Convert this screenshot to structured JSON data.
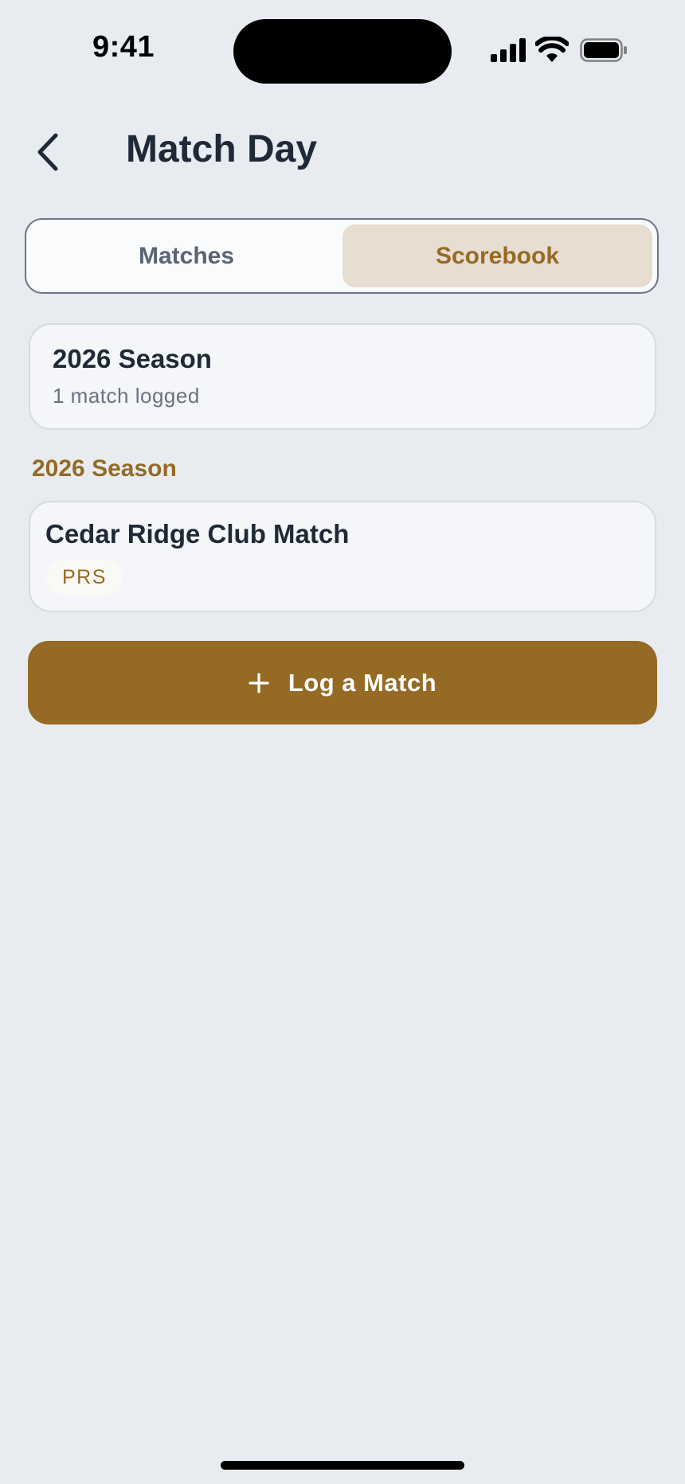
{
  "status_bar": {
    "time": "9:41"
  },
  "header": {
    "title": "Match Day"
  },
  "tabs": [
    {
      "label": "Matches",
      "selected": false
    },
    {
      "label": "Scorebook",
      "selected": true
    }
  ],
  "season_summary": {
    "title": "2026 Season",
    "subtitle": "1 match logged"
  },
  "section": {
    "label": "2026 Season"
  },
  "matches": [
    {
      "title": "Cedar Ridge Club Match",
      "badge": "PRS"
    }
  ],
  "actions": {
    "log_match_label": "Log a Match"
  },
  "colors": {
    "background": "#E8ECF0",
    "accent": "#956A24",
    "selected_tab_bg": "#E8DDD1",
    "text_primary": "#1F2937"
  }
}
